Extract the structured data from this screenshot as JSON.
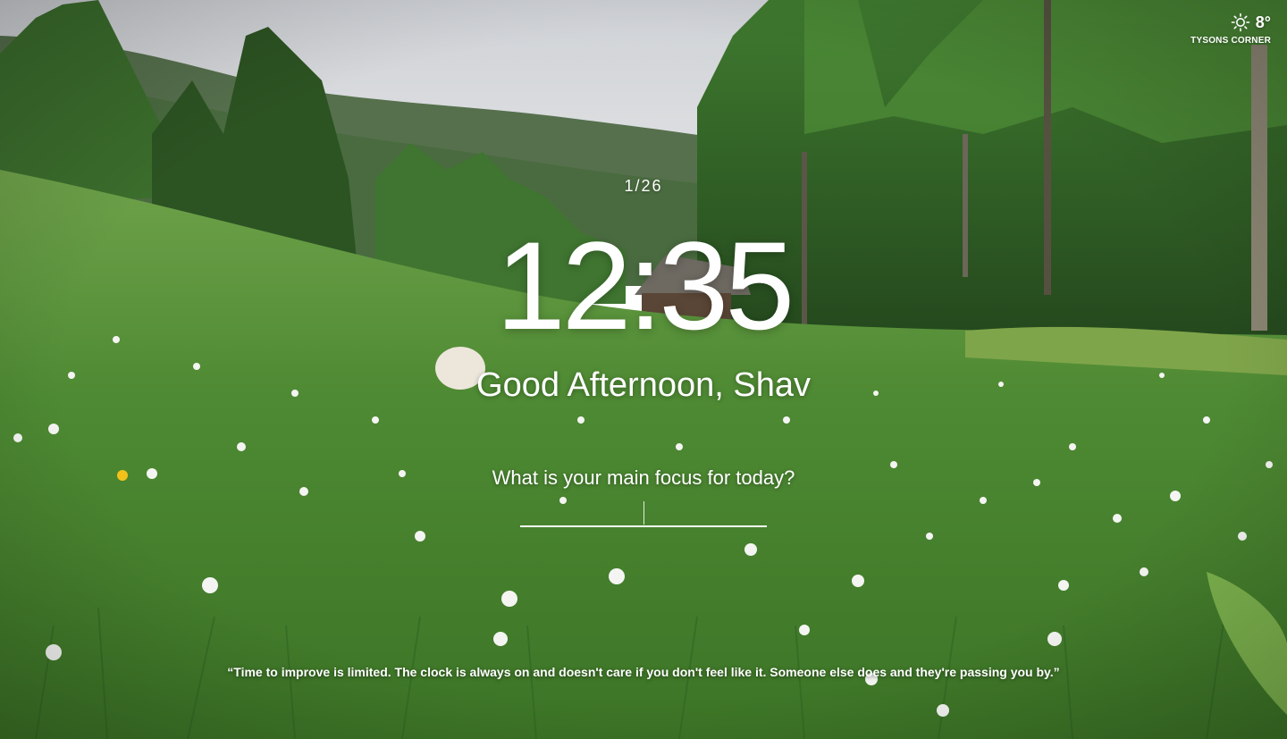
{
  "weather": {
    "icon": "sun-icon",
    "temperature": "8°",
    "location": "TYSONS CORNER"
  },
  "counter": "1/26",
  "clock": {
    "time": "12:35"
  },
  "greeting": "Good Afternoon, Shav",
  "focus": {
    "prompt": "What is your main focus for today?",
    "value": ""
  },
  "quote": {
    "text": "“Time to improve is limited. The clock is always on and doesn't care if you don't feel like it. Someone else does and they're passing you by.”"
  },
  "colors": {
    "sky": "#d8dadd",
    "mountain": "#4a6a45",
    "forest": "#2f5a2a",
    "meadow": "#4f8a36",
    "text": "#ffffff"
  }
}
